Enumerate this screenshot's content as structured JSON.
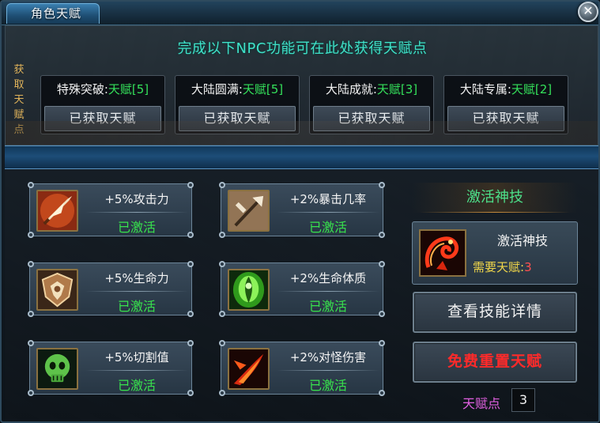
{
  "window": {
    "title": "角色天赋",
    "close_symbol": "✕"
  },
  "acquire_section": {
    "side_label": [
      "获",
      "取",
      "天",
      "赋",
      "点"
    ],
    "header": "完成以下NPC功能可在此处获得天赋点",
    "sources": [
      {
        "name": "特殊突破:",
        "reward": "天赋[5]",
        "button": "已获取天赋"
      },
      {
        "name": "大陆圆满:",
        "reward": "天赋[5]",
        "button": "已获取天赋"
      },
      {
        "name": "大陆成就:",
        "reward": "天赋[3]",
        "button": "已获取天赋"
      },
      {
        "name": "大陆专属:",
        "reward": "天赋[2]",
        "button": "已获取天赋"
      }
    ]
  },
  "talents": [
    {
      "effect": "+5%攻击力",
      "status": "已激活",
      "icon": "spear-tip-icon"
    },
    {
      "effect": "+2%暴击几率",
      "status": "已激活",
      "icon": "crossed-axe-icon"
    },
    {
      "effect": "+5%生命力",
      "status": "已激活",
      "icon": "shield-emblem-icon"
    },
    {
      "effect": "+2%生命体质",
      "status": "已激活",
      "icon": "green-aura-icon"
    },
    {
      "effect": "+5%切割值",
      "status": "已激活",
      "icon": "green-skull-icon"
    },
    {
      "effect": "+2%对怪伤害",
      "status": "已激活",
      "icon": "fire-slash-icon"
    }
  ],
  "divine_skill": {
    "header": "激活神技",
    "card_name": "激活神技",
    "requirement_label": "需要天赋:",
    "requirement_value": "3",
    "icon": "fire-dragon-icon"
  },
  "buttons": {
    "view_details": "查看技能详情",
    "free_reset": "免费重置天赋"
  },
  "points": {
    "label": "天赋点",
    "value": "3"
  },
  "colors": {
    "header_cyan": "#3fe1c8",
    "active_green": "#38e24d",
    "reward_green": "#34e05a",
    "requirement_yellow": "#f0d64a",
    "requirement_red": "#ff5050",
    "reset_red": "#ff2a2a",
    "points_magenta": "#e060e0"
  }
}
